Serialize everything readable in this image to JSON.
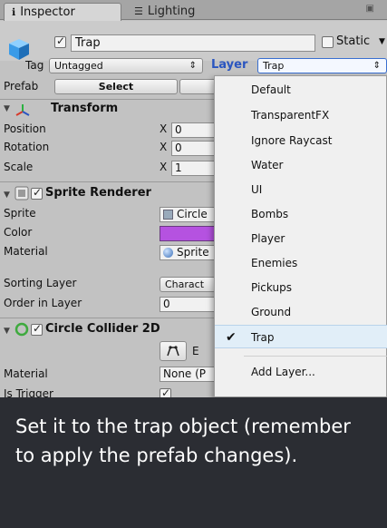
{
  "tabs": {
    "inspector": "Inspector",
    "lighting": "Lighting"
  },
  "object": {
    "name": "Trap",
    "static_label": "Static"
  },
  "tag": {
    "label": "Tag",
    "value": "Untagged"
  },
  "layer": {
    "label": "Layer",
    "value": "Trap"
  },
  "prefab": {
    "label": "Prefab",
    "select": "Select"
  },
  "transform": {
    "title": "Transform",
    "position": "Position",
    "rotation": "Rotation",
    "scale": "Scale",
    "axis": "X",
    "pos_x": "0",
    "rot_x": "0",
    "scale_x": "1"
  },
  "sprite_renderer": {
    "title": "Sprite Renderer",
    "sprite_label": "Sprite",
    "sprite_value": "Circle",
    "color_label": "Color",
    "color_value": "#b552e0",
    "material_label": "Material",
    "material_value": "Sprite",
    "sorting_layer_label": "Sorting Layer",
    "sorting_layer_value": "Charact",
    "order_label": "Order in Layer",
    "order_value": "0"
  },
  "circle_collider": {
    "title": "Circle Collider 2D",
    "edit_label": "E",
    "material_label": "Material",
    "material_value": "None (P",
    "trigger_label": "Is Trigger"
  },
  "layer_menu": {
    "items": [
      "Default",
      "TransparentFX",
      "Ignore Raycast",
      "Water",
      "UI",
      "Bombs",
      "Player",
      "Enemies",
      "Pickups",
      "Ground",
      "Trap"
    ],
    "selected": "Trap",
    "add_layer": "Add Layer..."
  },
  "caption": {
    "text": "Set it to the trap object (remember to apply the prefab changes)."
  },
  "colors": {
    "caption_bg": "#2b2d33",
    "accent_blue": "#3a6fd0"
  }
}
